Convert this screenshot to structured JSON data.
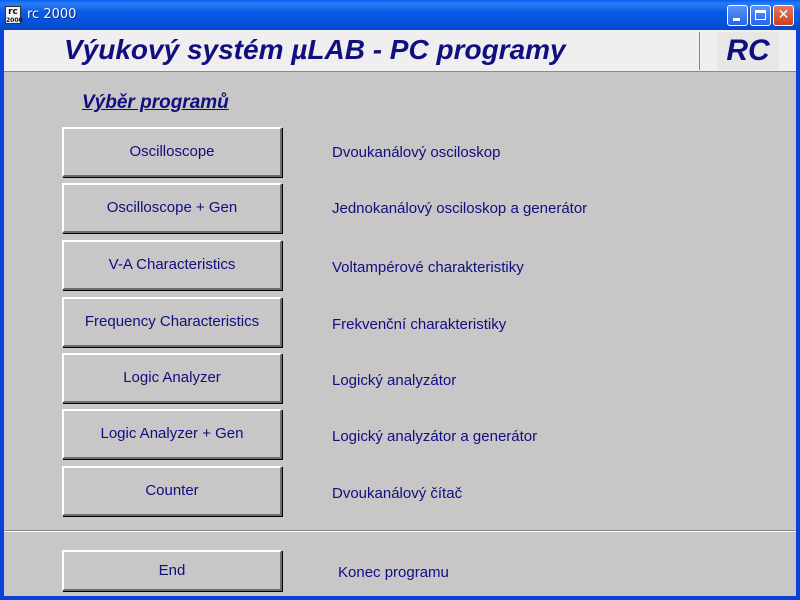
{
  "window": {
    "icon_line1": "rc",
    "icon_line2": "2000",
    "title": "rc 2000",
    "controls": {
      "minimize_icon": "minimize-icon",
      "maximize_icon": "maximize-icon",
      "close_glyph": "✕"
    }
  },
  "header": {
    "title": "Výukový systém µLAB - PC programy",
    "logo": "RC"
  },
  "section_title": "Výběr programů",
  "programs": [
    {
      "label": "Oscilloscope",
      "description": "Dvoukanálový osciloskop"
    },
    {
      "label": "Oscilloscope + Gen",
      "description": "Jednokanálový osciloskop a generátor"
    },
    {
      "label": "V-A Characteristics",
      "description": "Voltampérové charakteristiky"
    },
    {
      "label": "Frequency Characteristics",
      "description": "Frekvenční charakteristiky"
    },
    {
      "label": "Logic Analyzer",
      "description": "Logický analyzátor"
    },
    {
      "label": "Logic Analyzer + Gen",
      "description": "Logický analyzátor a generátor"
    },
    {
      "label": "Counter",
      "description": "Dvoukanálový čítač"
    }
  ],
  "end": {
    "label": "End",
    "description": "Konec programu"
  },
  "colors": {
    "text": "#0f0f80",
    "face": "#c8c6c6",
    "titlebar": "#0350d8"
  }
}
